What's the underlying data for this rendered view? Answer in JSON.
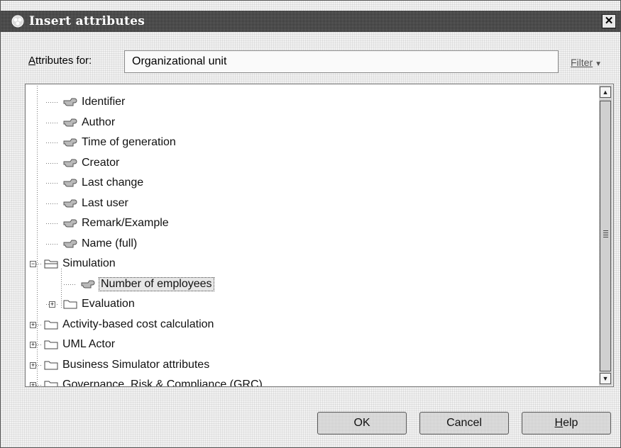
{
  "dialog": {
    "title": "Insert attributes",
    "close_glyph": "✕"
  },
  "attributes_for": {
    "label_accel": "A",
    "label_rest": "ttributes for:",
    "value": "Organizational unit"
  },
  "filter": {
    "label": "Filter",
    "arrow": "▼"
  },
  "tree": {
    "items": [
      {
        "label": "Identifier",
        "icon": "attribute-icon",
        "level": 1
      },
      {
        "label": "Author",
        "icon": "attribute-icon",
        "level": 1
      },
      {
        "label": "Time of generation",
        "icon": "attribute-icon",
        "level": 1
      },
      {
        "label": "Creator",
        "icon": "attribute-icon",
        "level": 1
      },
      {
        "label": "Last change",
        "icon": "attribute-icon",
        "level": 1
      },
      {
        "label": "Last user",
        "icon": "attribute-icon",
        "level": 1
      },
      {
        "label": "Remark/Example",
        "icon": "attribute-icon",
        "level": 1
      },
      {
        "label": "Name (full)",
        "icon": "attribute-icon",
        "level": 1
      },
      {
        "label": "Simulation",
        "icon": "folder-open-icon",
        "level": 0,
        "expander": "−"
      },
      {
        "label": "Number of employees",
        "icon": "attribute-icon",
        "level": 2,
        "selected": true
      },
      {
        "label": "Evaluation",
        "icon": "folder-icon",
        "level": 1,
        "expander": "+"
      },
      {
        "label": "Activity-based cost calculation",
        "icon": "folder-icon",
        "level": 0,
        "expander": "+"
      },
      {
        "label": "UML Actor",
        "icon": "folder-icon",
        "level": 0,
        "expander": "+"
      },
      {
        "label": "Business Simulator attributes",
        "icon": "folder-icon",
        "level": 0,
        "expander": "+"
      },
      {
        "label": "Governance, Risk & Compliance (GRC)",
        "icon": "folder-icon",
        "level": 0,
        "expander": "+"
      }
    ]
  },
  "scrollbar": {
    "up_glyph": "▲",
    "down_glyph": "▼"
  },
  "buttons": {
    "ok": "OK",
    "cancel": "Cancel",
    "help_accel": "H",
    "help_rest": "elp"
  }
}
